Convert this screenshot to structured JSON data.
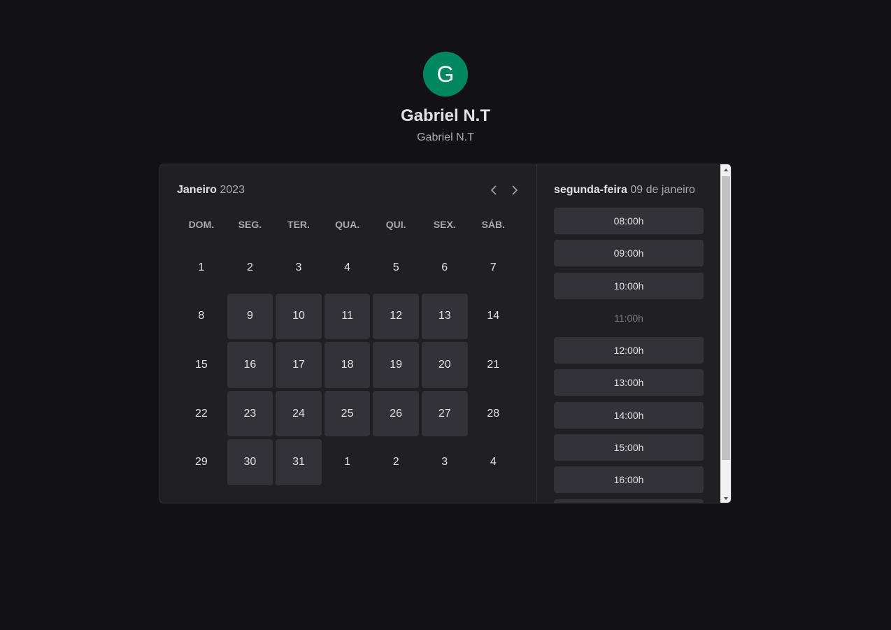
{
  "profile": {
    "initial": "G",
    "name": "Gabriel N.T",
    "subtitle": "Gabriel N.T",
    "avatar_color": "#00875f"
  },
  "calendar": {
    "month": "Janeiro",
    "year": "2023",
    "prev_icon": "chevron-left-icon",
    "next_icon": "chevron-right-icon",
    "weekdays": [
      "DOM.",
      "SEG.",
      "TER.",
      "QUA.",
      "QUI.",
      "SEX.",
      "SÁB."
    ],
    "days": [
      {
        "label": "1",
        "available": false
      },
      {
        "label": "2",
        "available": false
      },
      {
        "label": "3",
        "available": false
      },
      {
        "label": "4",
        "available": false
      },
      {
        "label": "5",
        "available": false
      },
      {
        "label": "6",
        "available": false
      },
      {
        "label": "7",
        "available": false
      },
      {
        "label": "8",
        "available": false
      },
      {
        "label": "9",
        "available": true
      },
      {
        "label": "10",
        "available": true
      },
      {
        "label": "11",
        "available": true
      },
      {
        "label": "12",
        "available": true
      },
      {
        "label": "13",
        "available": true
      },
      {
        "label": "14",
        "available": false
      },
      {
        "label": "15",
        "available": false
      },
      {
        "label": "16",
        "available": true
      },
      {
        "label": "17",
        "available": true
      },
      {
        "label": "18",
        "available": true
      },
      {
        "label": "19",
        "available": true
      },
      {
        "label": "20",
        "available": true
      },
      {
        "label": "21",
        "available": false
      },
      {
        "label": "22",
        "available": false
      },
      {
        "label": "23",
        "available": true
      },
      {
        "label": "24",
        "available": true
      },
      {
        "label": "25",
        "available": true
      },
      {
        "label": "26",
        "available": true
      },
      {
        "label": "27",
        "available": true
      },
      {
        "label": "28",
        "available": false
      },
      {
        "label": "29",
        "available": false
      },
      {
        "label": "30",
        "available": true
      },
      {
        "label": "31",
        "available": true
      },
      {
        "label": "1",
        "available": false
      },
      {
        "label": "2",
        "available": false
      },
      {
        "label": "3",
        "available": false
      },
      {
        "label": "4",
        "available": false
      }
    ]
  },
  "picker": {
    "weekday": "segunda-feira",
    "date": "09 de janeiro",
    "times": [
      {
        "label": "08:00h",
        "available": true
      },
      {
        "label": "09:00h",
        "available": true
      },
      {
        "label": "10:00h",
        "available": true
      },
      {
        "label": "11:00h",
        "available": false
      },
      {
        "label": "12:00h",
        "available": true
      },
      {
        "label": "13:00h",
        "available": true
      },
      {
        "label": "14:00h",
        "available": true
      },
      {
        "label": "15:00h",
        "available": true
      },
      {
        "label": "16:00h",
        "available": true
      },
      {
        "label": "",
        "available": true
      }
    ]
  },
  "colors": {
    "background": "#121214",
    "card": "#202024",
    "day_available": "#323238",
    "text_muted": "#a9a9b2",
    "disabled": "#7c7c8a"
  }
}
